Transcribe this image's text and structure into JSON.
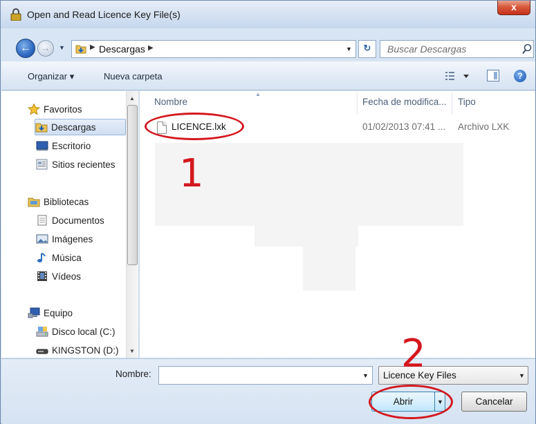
{
  "window": {
    "title": "Open and Read Licence Key File(s)",
    "close_glyph": "x"
  },
  "address": {
    "crumbs": [
      "Descargas"
    ],
    "search_placeholder": "Buscar Descargas"
  },
  "toolbar": {
    "organize_label": "Organizar ▾",
    "new_folder_label": "Nueva carpeta"
  },
  "nav": {
    "items": [
      {
        "label": "Favoritos",
        "icon": "star-icon",
        "selected": false
      },
      {
        "label": "Descargas",
        "icon": "downloads-folder-icon",
        "selected": true
      },
      {
        "label": "Escritorio",
        "icon": "desktop-icon",
        "selected": false
      },
      {
        "label": "Sitios recientes",
        "icon": "recent-places-icon",
        "selected": false
      },
      {
        "label": "Bibliotecas",
        "icon": "libraries-icon",
        "selected": false
      },
      {
        "label": "Documentos",
        "icon": "documents-icon",
        "selected": false
      },
      {
        "label": "Imágenes",
        "icon": "pictures-icon",
        "selected": false
      },
      {
        "label": "Música",
        "icon": "music-icon",
        "selected": false
      },
      {
        "label": "Vídeos",
        "icon": "videos-icon",
        "selected": false
      },
      {
        "label": "Equipo",
        "icon": "computer-icon",
        "selected": false
      },
      {
        "label": "Disco local (C:)",
        "icon": "local-disk-icon",
        "selected": false
      },
      {
        "label": "KINGSTON (D:)",
        "icon": "usb-drive-icon",
        "selected": false
      }
    ]
  },
  "filelist": {
    "columns": [
      "Nombre",
      "Fecha de modifica...",
      "Tipo"
    ],
    "rows": [
      {
        "name": "LICENCE.lxk",
        "date": "01/02/2013 07:41 ...",
        "type": "Archivo LXK"
      }
    ]
  },
  "bottom": {
    "name_label": "Nombre:",
    "name_value": "",
    "filter_value": "Licence Key Files",
    "open_label": "Abrir",
    "cancel_label": "Cancelar"
  },
  "annotations": {
    "step1": "1",
    "step2": "2",
    "color": "#d4171e"
  }
}
